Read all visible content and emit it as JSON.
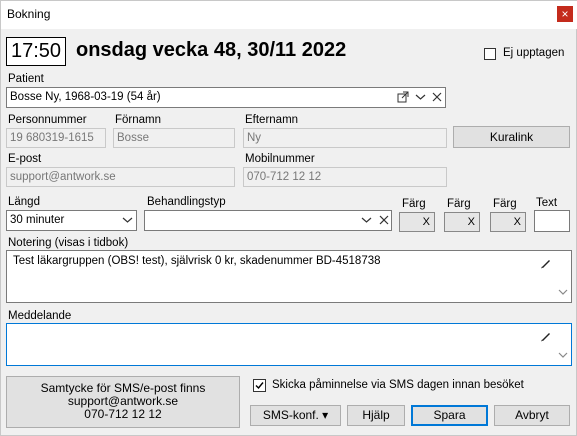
{
  "window": {
    "title": "Bokning",
    "close_glyph": "×"
  },
  "header": {
    "time": "17:50",
    "date": "onsdag vecka 48, 30/11 2022",
    "busy_label": "Ej upptagen",
    "busy_checked": false
  },
  "patient": {
    "label": "Patient",
    "value": "Bosse Ny, 1968-03-19 (54 år)"
  },
  "person": {
    "pnr_label": "Personnummer",
    "pnr_value": "19 680319-1615",
    "first_label": "Förnamn",
    "first_value": "Bosse",
    "last_label": "Efternamn",
    "last_value": "Ny",
    "kuralink_label": "Kuralink",
    "email_label": "E-post",
    "email_value": "support@antwork.se",
    "mobile_label": "Mobilnummer",
    "mobile_value": "070-712 12 12"
  },
  "booking": {
    "length_label": "Längd",
    "length_value": "30 minuter",
    "treatment_label": "Behandlingstyp",
    "treatment_value": "",
    "color_label": "Färg",
    "color_clear": "X",
    "text_label": "Text",
    "text_value": ""
  },
  "note": {
    "label": "Notering (visas i tidbok)",
    "value": "Test läkargruppen (OBS! test), självrisk 0 kr, skadenummer BD-4518738"
  },
  "message": {
    "label": "Meddelande",
    "value": ""
  },
  "consent": {
    "line1": "Samtycke för SMS/e-post finns",
    "line2": "support@antwork.se",
    "line3": "070-712 12 12"
  },
  "reminder": {
    "label": "Skicka påminnelse via SMS dagen innan besöket",
    "checked": true
  },
  "buttons": {
    "sms_conf": "SMS-konf. ▾",
    "help": "Hjälp",
    "save": "Spara",
    "cancel": "Avbryt"
  }
}
